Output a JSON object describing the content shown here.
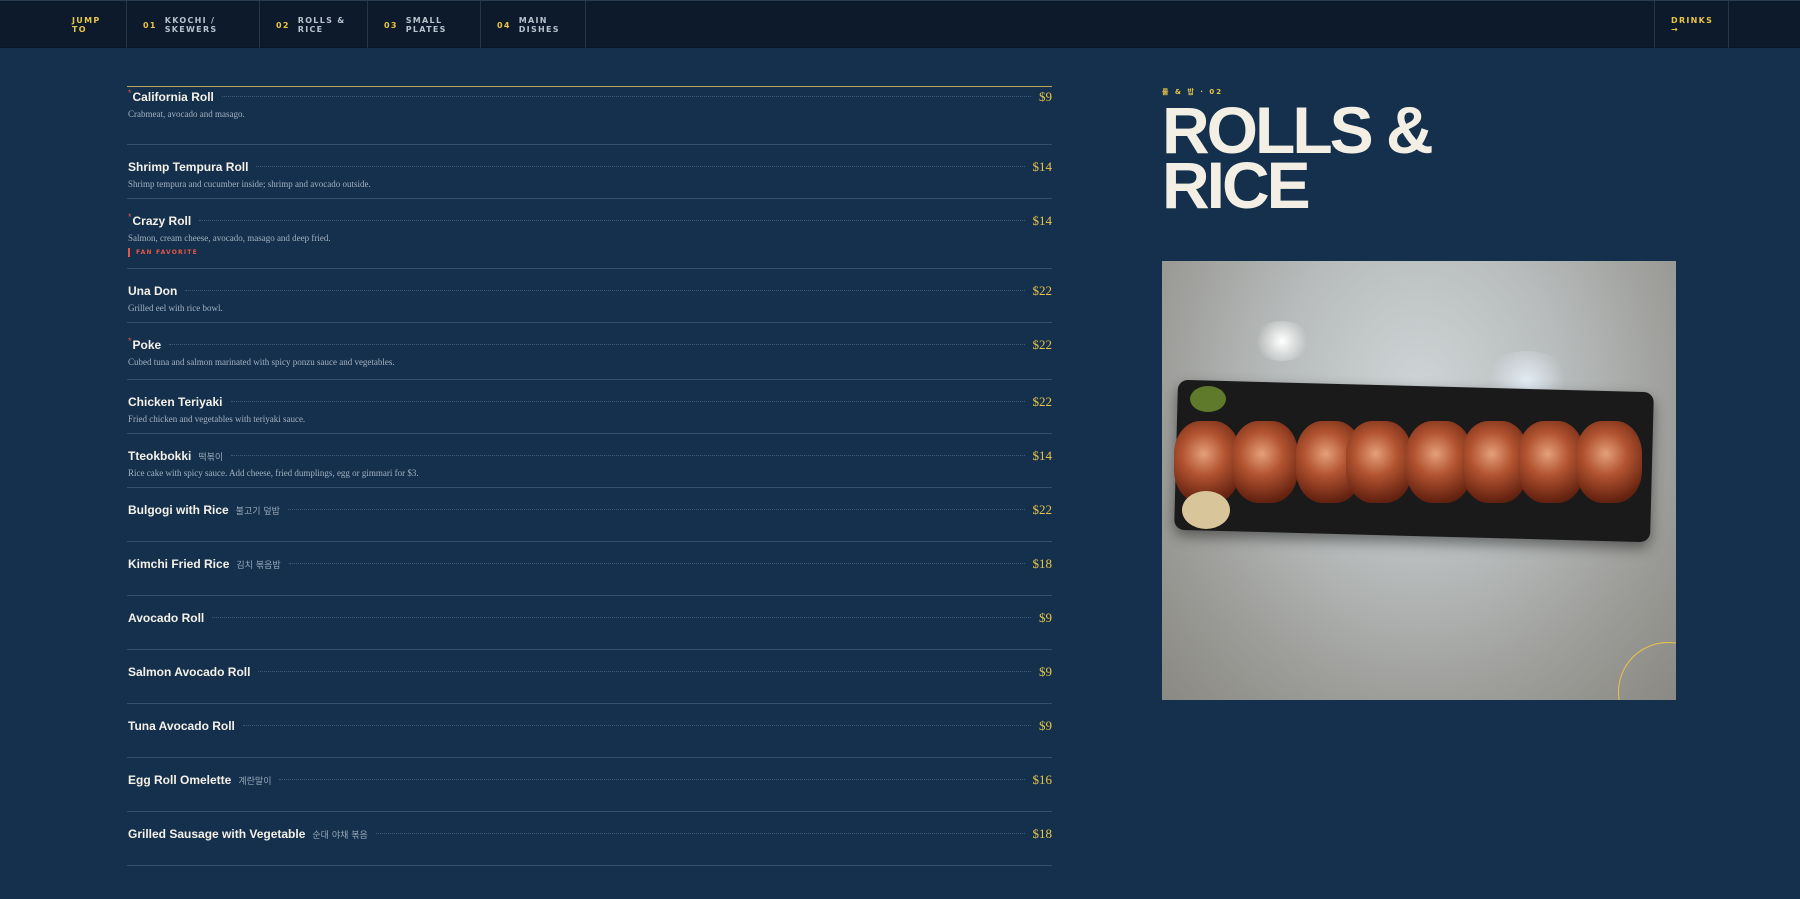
{
  "nav": {
    "jump_to": "JUMP TO",
    "items": [
      {
        "num": "01",
        "label": "KKOCHI / SKEWERS"
      },
      {
        "num": "02",
        "label": "ROLLS & RICE"
      },
      {
        "num": "03",
        "label": "SMALL PLATES"
      },
      {
        "num": "04",
        "label": "MAIN DISHES"
      }
    ],
    "drinks": "DRINKS →"
  },
  "section": {
    "eyebrow": "롤 & 밥 · 02",
    "title": "ROLLS & RICE"
  },
  "menu": [
    {
      "name": "California Roll",
      "star": "*",
      "korean": "",
      "price": "$9",
      "desc": "Crabmeat, avocado and masago.",
      "badge": ""
    },
    {
      "name": "Shrimp Tempura Roll",
      "star": "",
      "korean": "",
      "price": "$14",
      "desc": "Shrimp tempura and cucumber inside; shrimp and avocado outside.",
      "badge": ""
    },
    {
      "name": "Crazy Roll",
      "star": "*",
      "korean": "",
      "price": "$14",
      "desc": "Salmon, cream cheese, avocado, masago and deep fried.",
      "badge": "FAN FAVORITE"
    },
    {
      "name": "Una Don",
      "star": "",
      "korean": "",
      "price": "$22",
      "desc": "Grilled eel with rice bowl.",
      "badge": ""
    },
    {
      "name": "Poke",
      "star": "*",
      "korean": "",
      "price": "$22",
      "desc": "Cubed tuna and salmon marinated with spicy ponzu sauce and vegetables.",
      "badge": ""
    },
    {
      "name": "Chicken Teriyaki",
      "star": "",
      "korean": "",
      "price": "$22",
      "desc": "Fried chicken and vegetables with teriyaki sauce.",
      "badge": ""
    },
    {
      "name": "Tteokbokki",
      "star": "",
      "korean": "떡볶이",
      "price": "$14",
      "desc": "Rice cake with spicy sauce. Add cheese, fried dumplings, egg or gimmari for $3.",
      "badge": ""
    },
    {
      "name": "Bulgogi with Rice",
      "star": "",
      "korean": "불고기 덮밥",
      "price": "$22",
      "desc": "",
      "badge": ""
    },
    {
      "name": "Kimchi Fried Rice",
      "star": "",
      "korean": "김치 볶음밥",
      "price": "$18",
      "desc": "",
      "badge": ""
    },
    {
      "name": "Avocado Roll",
      "star": "",
      "korean": "",
      "price": "$9",
      "desc": "",
      "badge": ""
    },
    {
      "name": "Salmon Avocado Roll",
      "star": "",
      "korean": "",
      "price": "$9",
      "desc": "",
      "badge": ""
    },
    {
      "name": "Tuna Avocado Roll",
      "star": "",
      "korean": "",
      "price": "$9",
      "desc": "",
      "badge": ""
    },
    {
      "name": "Egg Roll Omelette",
      "star": "",
      "korean": "계란말이",
      "price": "$16",
      "desc": "",
      "badge": ""
    },
    {
      "name": "Grilled Sausage with Vegetable",
      "star": "",
      "korean": "순대 야채 볶음",
      "price": "$18",
      "desc": "",
      "badge": ""
    }
  ],
  "colors": {
    "background": "#14304c",
    "nav_bg": "#0c1a2b",
    "accent_gold": "#e8c547",
    "accent_red": "#e4574a",
    "text_cream": "#f4efe4"
  },
  "icons": {
    "drinks_arrow": "arrow-right-icon"
  }
}
